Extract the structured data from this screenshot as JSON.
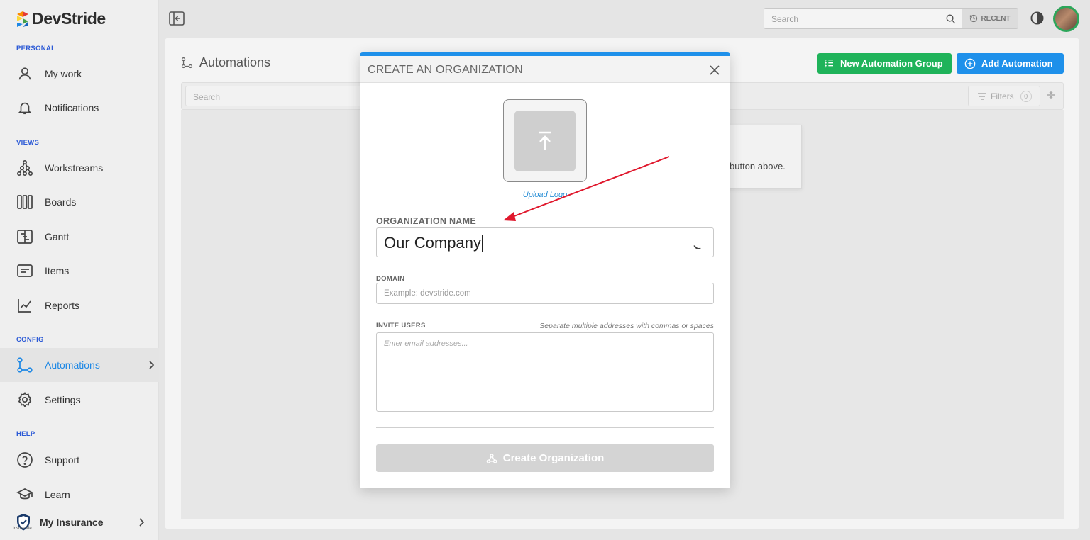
{
  "app": {
    "name": "DevStride",
    "brand_colors": [
      "#e53935",
      "#1e88e5",
      "#43a047",
      "#fdd835"
    ]
  },
  "sidebar": {
    "sections": [
      {
        "label": "PERSONAL"
      },
      {
        "label": "VIEWS"
      },
      {
        "label": "CONFIG"
      },
      {
        "label": "HELP"
      }
    ],
    "items": [
      {
        "label": "My work",
        "icon": "person-icon"
      },
      {
        "label": "Notifications",
        "icon": "bell-icon"
      },
      {
        "label": "Workstreams",
        "icon": "workstreams-icon"
      },
      {
        "label": "Boards",
        "icon": "boards-icon"
      },
      {
        "label": "Gantt",
        "icon": "gantt-icon"
      },
      {
        "label": "Items",
        "icon": "items-icon"
      },
      {
        "label": "Reports",
        "icon": "reports-icon"
      },
      {
        "label": "Automations",
        "icon": "automations-icon",
        "active": true
      },
      {
        "label": "Settings",
        "icon": "gear-icon"
      },
      {
        "label": "Support",
        "icon": "help-icon"
      },
      {
        "label": "Learn",
        "icon": "graduation-cap-icon"
      }
    ],
    "organization": {
      "label": "My Insurance",
      "tag": "Insure Me"
    }
  },
  "topbar": {
    "search_placeholder": "Search",
    "recent_label": "RECENT"
  },
  "page": {
    "title": "Automations",
    "new_group_label": "New Automation Group",
    "add_label": "Add Automation",
    "list_search_placeholder": "Search",
    "filters_label": "Filters",
    "filters_count": "0",
    "empty_hint": "button above."
  },
  "modal": {
    "title": "CREATE AN ORGANIZATION",
    "upload_link": "Upload Logo",
    "org_name_label": "ORGANIZATION NAME",
    "org_name_value": "Our Company",
    "domain_label": "DOMAIN",
    "domain_placeholder": "Example: devstride.com",
    "invite_label": "INVITE USERS",
    "invite_hint": "Separate multiple addresses with commas or spaces",
    "invite_placeholder": "Enter email addresses...",
    "create_label": "Create Organization"
  },
  "colors": {
    "accent_blue": "#1e90ea",
    "accent_green": "#1fb35a",
    "active_nav": "#1e88e5",
    "annotation_red": "#e0182d"
  }
}
